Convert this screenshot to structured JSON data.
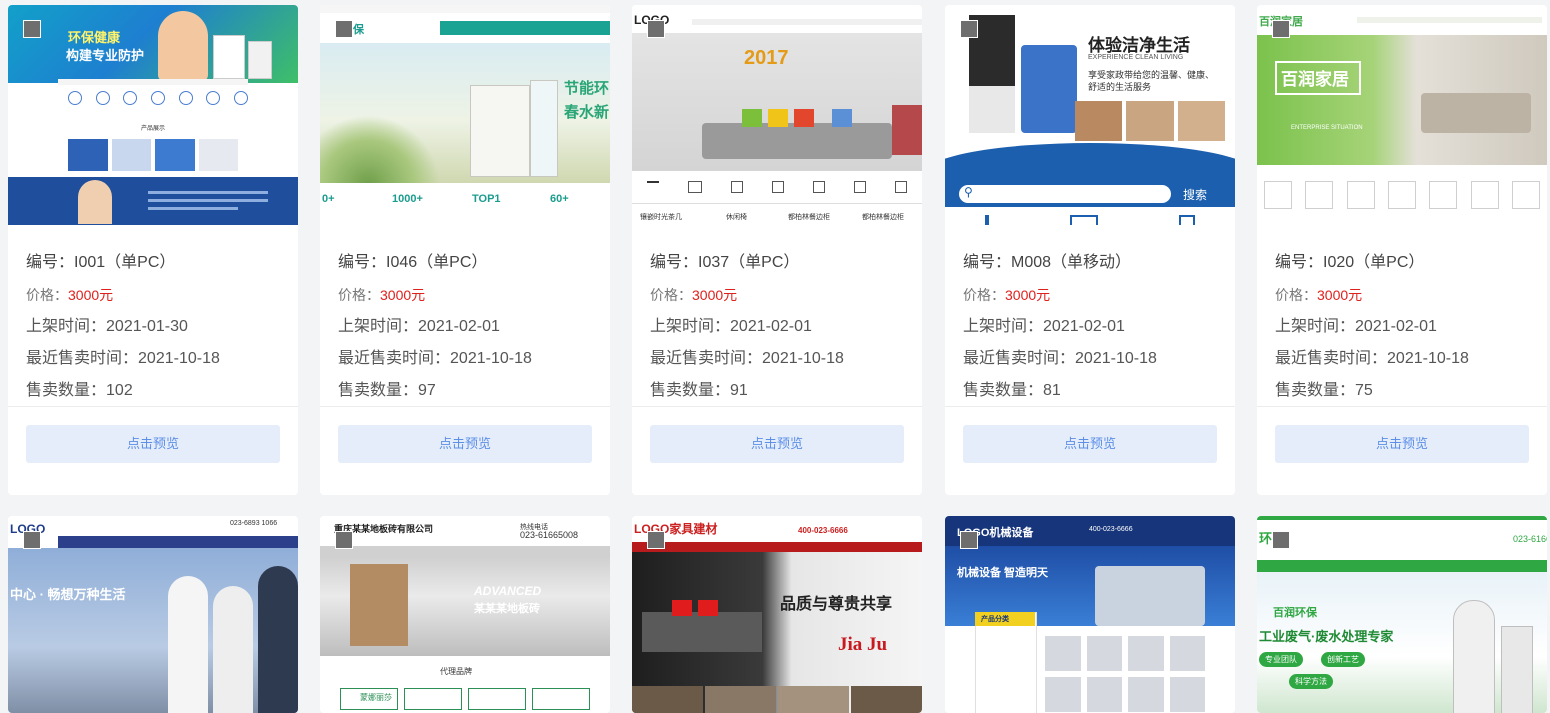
{
  "cards": [
    {
      "code_label": "编号：",
      "code": "I001（单PC）",
      "price_label": "价格：",
      "price": "3000元",
      "listed_label": "上架时间：",
      "listed": "2021-01-30",
      "last_sold_label": "最近售卖时间：",
      "last_sold": "2021-10-18",
      "sold_count_label": "售卖数量：",
      "sold_count": "102",
      "preview_label": "点击预览",
      "thumb": {
        "headline": "环保健康",
        "headline2": "构建专业防护",
        "section_title": "产品展示"
      }
    },
    {
      "code_label": "编号：",
      "code": "I046（单PC）",
      "price_label": "价格：",
      "price": "3000元",
      "listed_label": "上架时间：",
      "listed": "2021-02-01",
      "last_sold_label": "最近售卖时间：",
      "last_sold": "2021-10-18",
      "sold_count_label": "售卖数量：",
      "sold_count": "97",
      "preview_label": "点击预览",
      "thumb": {
        "logo": "环保",
        "tagline": "节能环",
        "tagline2": "春水新",
        "stat1": "1000+",
        "stat2": "TOP1",
        "stat3": "60+"
      }
    },
    {
      "code_label": "编号：",
      "code": "I037（单PC）",
      "price_label": "价格：",
      "price": "3000元",
      "listed_label": "上架时间：",
      "listed": "2021-02-01",
      "last_sold_label": "最近售卖时间：",
      "last_sold": "2021-10-18",
      "sold_count_label": "售卖数量：",
      "sold_count": "91",
      "preview_label": "点击预览",
      "thumb": {
        "logo": "LOGO",
        "year": "2017",
        "cat1": "镶嵌时光茶几",
        "cat2": "休闲椅",
        "cat3": "都柏林餐边柜",
        "cat4": "都柏林餐边柜"
      }
    },
    {
      "code_label": "编号：",
      "code": "M008（单移动）",
      "price_label": "价格：",
      "price": "3000元",
      "listed_label": "上架时间：",
      "listed": "2021-02-01",
      "last_sold_label": "最近售卖时间：",
      "last_sold": "2021-10-18",
      "sold_count_label": "售卖数量：",
      "sold_count": "81",
      "preview_label": "点击预览",
      "thumb": {
        "headline": "体验洁净生活",
        "sub": "EXPERIENCE CLEAN LIVING",
        "desc1": "享受家政带给您的温馨、健康、",
        "desc2": "舒适的生活服务",
        "search_btn": "搜索"
      }
    },
    {
      "code_label": "编号：",
      "code": "I020（单PC）",
      "price_label": "价格：",
      "price": "3000元",
      "listed_label": "上架时间：",
      "listed": "2021-02-01",
      "last_sold_label": "最近售卖时间：",
      "last_sold": "2021-10-18",
      "sold_count_label": "售卖数量：",
      "sold_count": "75",
      "preview_label": "点击预览",
      "thumb": {
        "logo": "百润家居",
        "headline": "百润家居",
        "sub": "ENTERPRISE SITUATION"
      }
    },
    {
      "thumb": {
        "logo": "LOGO",
        "phone": "023-6893 1066",
        "headline": "中心 · 畅想万种生活"
      }
    },
    {
      "thumb": {
        "company": "重庆某某地板砖有限公司",
        "phone_label": "热线电话",
        "phone": "023-61665008",
        "banner": "ADVANCED",
        "banner2": "某某某地板砖",
        "section": "代理品牌",
        "brand": "蒙娜丽莎"
      }
    },
    {
      "thumb": {
        "logo": "LOGO家具建材",
        "phone": "400-023-6666",
        "headline": "品质与尊贵共享",
        "brand": "Jia Ju"
      }
    },
    {
      "thumb": {
        "logo": "LOGO机械设备",
        "phone": "400-023-6666",
        "headline": "机械设备 智造明天",
        "side_title": "产品分类"
      }
    },
    {
      "thumb": {
        "logo": "环保",
        "phone": "023-6166",
        "brand": "百润环保",
        "headline": "工业废气·废水处理专家",
        "tag1": "专业团队",
        "tag2": "创新工艺",
        "tag3": "科学方法"
      }
    }
  ]
}
